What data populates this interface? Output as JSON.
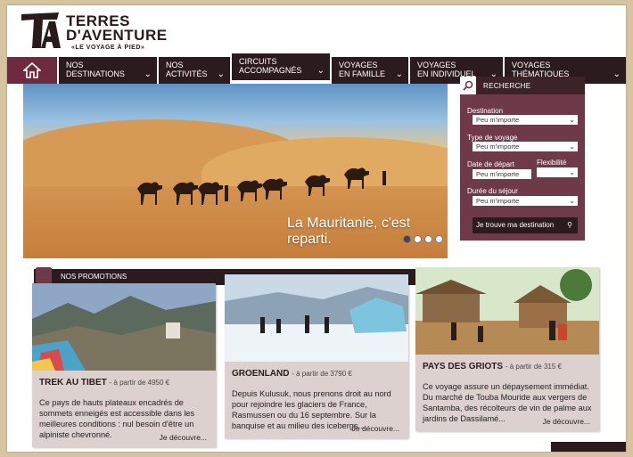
{
  "brand": {
    "logo_mark": "TA",
    "title_line1": "TERRES",
    "title_line2": "D'AVENTURE",
    "tagline": "«LE VOYAGE À PIED»"
  },
  "nav": {
    "home_icon": "home-icon",
    "items": [
      {
        "line1": "NOS",
        "line2": "DESTINATIONS"
      },
      {
        "line1": "NOS",
        "line2": "ACTIVITÉS"
      },
      {
        "line1": "CIRCUITS",
        "line2": "ACCOMPAGNÉS"
      },
      {
        "line1": "VOYAGES",
        "line2": "EN FAMILLE"
      },
      {
        "line1": "VOYAGES",
        "line2": "EN INDIVIDUEL"
      },
      {
        "line1": "VOYAGES",
        "line2": "THÉMATIQUES"
      }
    ]
  },
  "hero": {
    "caption": "La Mauritanie, c'est reparti.",
    "slides_total": 4,
    "active_slide": 1
  },
  "search": {
    "heading": "RECHERCHE",
    "destination_label": "Destination",
    "destination_value": "Peu m'importe",
    "type_label": "Type de voyage",
    "type_value": "Peu m'importe",
    "date_label": "Date de départ",
    "date_value": "Peu m'importe",
    "flex_label": "Flexibilité",
    "flex_value": "",
    "duration_label": "Durée du séjour",
    "duration_value": "Peu m'importe",
    "submit_label": "Je trouve ma destination"
  },
  "promotions": {
    "heading": "NOS PROMOTIONS",
    "cards": [
      {
        "title": "TREK AU TIBET",
        "price": "- à partir de 4950 €",
        "desc": "Ce pays de hauts plateaux encadrés de sommets enneigés est accessible dans les meilleures conditions : nul besoin d'être un alpiniste chevronné.",
        "more": "Je découvre..."
      },
      {
        "title": "GROENLAND",
        "price": "- à partir de 3790 €",
        "desc": "Depuis Kulusuk, nous prenons droit au nord pour rejoindre les glaciers de France, Rasmussen ou du 16 septembre. Sur la banquise et au milieu des icebergs...",
        "more": "Je découvre..."
      },
      {
        "title": "PAYS DES GRIOTS",
        "price": "- à partir de 315 €",
        "desc": "Ce voyage assure un dépaysement immédiat. Du marché de Touba Mouride aux vergers de Santamba, des récolteurs de vin de palme aux jardins de Dassilamé...",
        "more": "Je découvre..."
      }
    ]
  }
}
